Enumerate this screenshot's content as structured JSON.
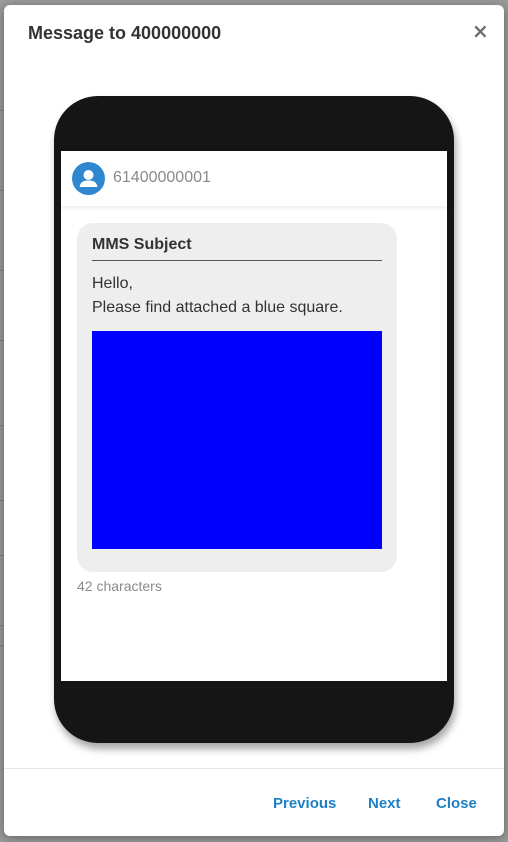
{
  "modal": {
    "title": "Message to 400000000",
    "close_icon": "×"
  },
  "phone": {
    "contact": {
      "icon": "user-icon",
      "number": "61400000001"
    },
    "message": {
      "subject": "MMS Subject",
      "body_lines": [
        "Hello,",
        "Please find attached a blue square."
      ],
      "attachment_color": "#0000ff"
    },
    "char_count": "42 characters"
  },
  "footer": {
    "previous_label": "Previous",
    "next_label": "Next",
    "close_label": "Close"
  },
  "colors": {
    "accent": "#1f80c6",
    "avatar": "#2f87cf",
    "bubble": "#eeeeee",
    "phone_frame": "#151515"
  }
}
